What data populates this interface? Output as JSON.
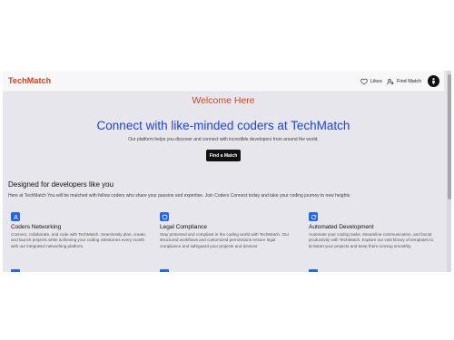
{
  "brand": "TechMatch",
  "nav": {
    "likes_label": "Likes",
    "find_label": "Find Match"
  },
  "hero": {
    "welcome": "Welcome Here",
    "title": "Connect with like-minded coders at TechMatch",
    "subtitle": "Our platform helps you discover and connect with incredible developers from around the world.",
    "cta_label": "Find a Match"
  },
  "section": {
    "title": "Designed for developers like you",
    "subtitle": "Here at TechMatch You will be matched with fellow coders who share your passion and expertise. Join Coders Connect today and take your coding journey to new heights"
  },
  "features": [
    {
      "icon": "network-icon",
      "title": "Coders Networking",
      "description": "Connect, collaborate, and code with TechMatch. Seamlessly plan, create, and launch projects while achieving your coding milestones every month with our integrated networking platform."
    },
    {
      "icon": "shield-icon",
      "title": "Legal Compliance",
      "description": "Stay protected and compliant in the coding world with TechMatch. Our structured workflows and customized permissions ensure legal compliance and safeguard your projects and devices"
    },
    {
      "icon": "refresh-icon",
      "title": "Automated Development",
      "description": "Automate your coding tasks, streamline communication, and boost productivity with TechMatch. Explore our vast library of templates to kickstart your projects and keep them running smoothly."
    }
  ],
  "colors": {
    "brand": "#c9421c",
    "hero_title": "#1f45d6",
    "accent": "#2466e8",
    "page_bg": "#e6e6ec"
  }
}
